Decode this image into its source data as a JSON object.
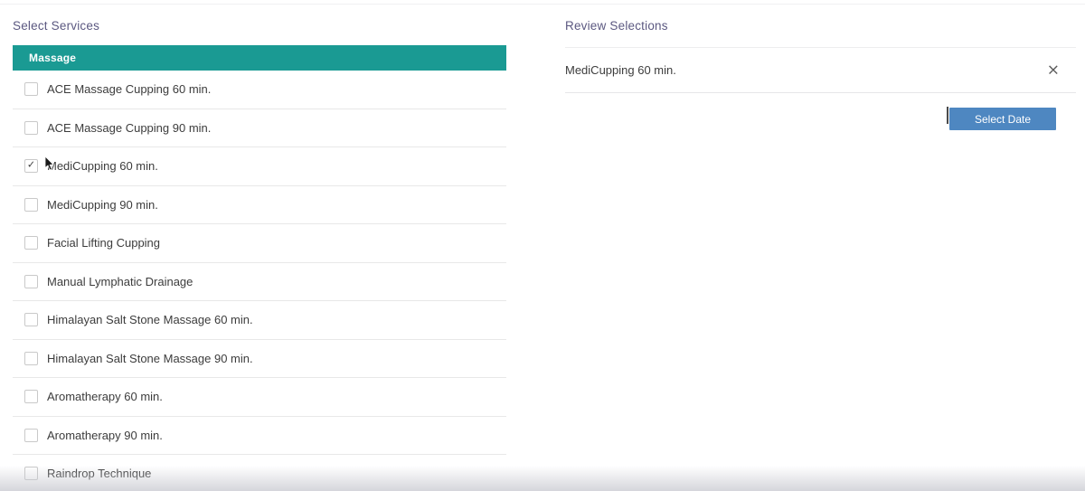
{
  "colors": {
    "category_teal": "#1a9a93",
    "button_blue": "#4e87c1",
    "heading_purple": "#5b5880",
    "item_text": "#3c3c3c"
  },
  "services_panel": {
    "title": "Select Services",
    "category_header": "Massage",
    "items": [
      {
        "label": "ACE Massage Cupping 60 min.",
        "checked": false
      },
      {
        "label": "ACE Massage Cupping 90 min.",
        "checked": false
      },
      {
        "label": "MediCupping 60 min.",
        "checked": true
      },
      {
        "label": "MediCupping 90 min.",
        "checked": false
      },
      {
        "label": "Facial Lifting Cupping",
        "checked": false
      },
      {
        "label": "Manual Lymphatic Drainage",
        "checked": false
      },
      {
        "label": "Himalayan Salt Stone Massage 60 min.",
        "checked": false
      },
      {
        "label": "Himalayan Salt Stone Massage 90 min.",
        "checked": false
      },
      {
        "label": "Aromatherapy 60 min.",
        "checked": false
      },
      {
        "label": "Aromatherapy 90 min.",
        "checked": false
      },
      {
        "label": "Raindrop Technique",
        "checked": false
      }
    ],
    "checkmark_glyph": "✓"
  },
  "review_panel": {
    "title": "Review Selections",
    "selections": [
      {
        "label": "MediCupping 60 min.",
        "remove_icon": "×"
      }
    ],
    "select_date_button": "Select Date"
  }
}
